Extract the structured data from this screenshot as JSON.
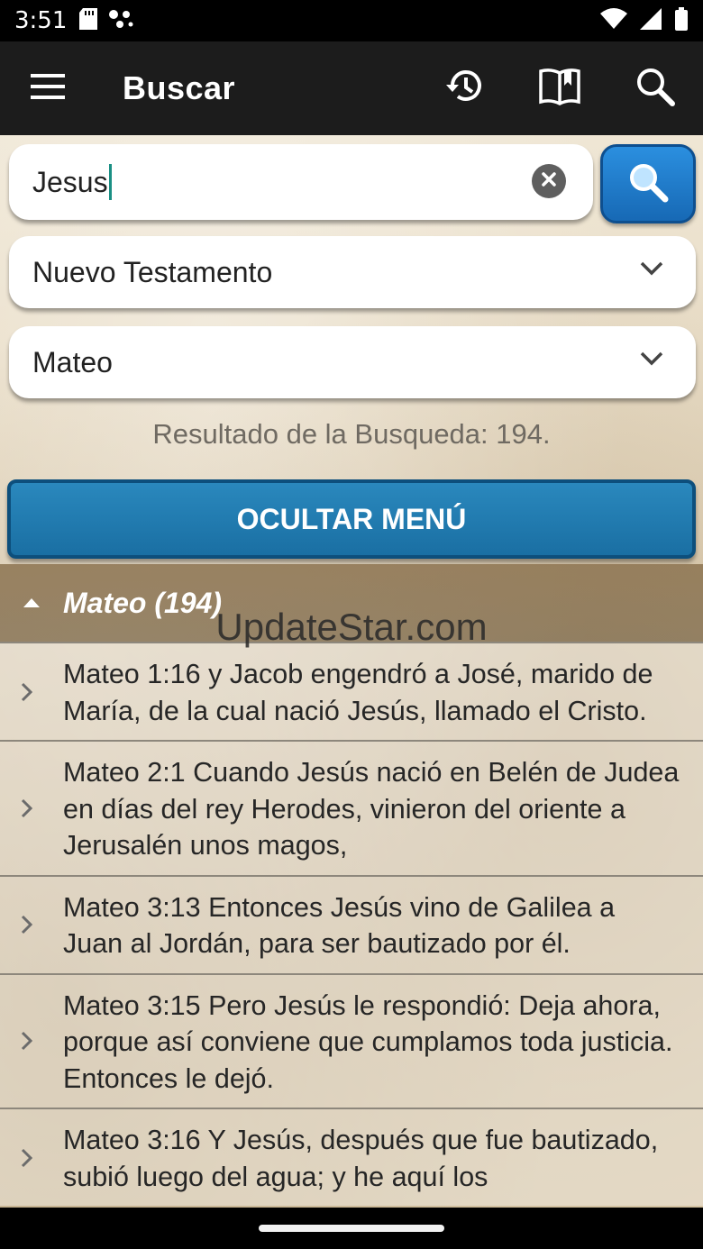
{
  "status_bar": {
    "time": "3:51",
    "left_icons": [
      "sd-card-icon",
      "dots-icon"
    ],
    "right_icons": [
      "wifi-icon",
      "signal-icon",
      "battery-icon"
    ]
  },
  "app_bar": {
    "title": "Buscar",
    "icons": [
      "menu-icon",
      "history-icon",
      "book-icon",
      "search-icon"
    ]
  },
  "search": {
    "value": "Jesus",
    "clear_icon": "clear-icon",
    "go_icon": "search-icon"
  },
  "filters": {
    "testament": "Nuevo Testamento",
    "book": "Mateo"
  },
  "result_count": "Resultado de la Busqueda: 194.",
  "hide_menu_label": "OCULTAR MENÚ",
  "group": {
    "title": "Mateo (194)"
  },
  "watermark": "UpdateStar.com",
  "results": [
    {
      "text": "Mateo 1:16 y Jacob engendró a José, marido de María, de la cual nació Jesús, llamado el Cristo."
    },
    {
      "text": "Mateo 2:1 Cuando Jesús nació en Belén de Judea en días del rey Herodes, vinieron del oriente a Jerusalén unos magos,"
    },
    {
      "text": "Mateo 3:13 Entonces Jesús vino de Galilea a Juan al Jordán, para ser bautizado por él."
    },
    {
      "text": "Mateo 3:15 Pero Jesús le respondió: Deja ahora, porque así conviene que cumplamos toda justicia. Entonces le dejó."
    },
    {
      "text": "Mateo 3:16 Y Jesús, después que fue bautizado, subió luego del agua; y he aquí los"
    }
  ],
  "colors": {
    "app_bar": "#1c1c1c",
    "accent_blue": "#1a6fa3",
    "caret": "#1b8f84"
  }
}
